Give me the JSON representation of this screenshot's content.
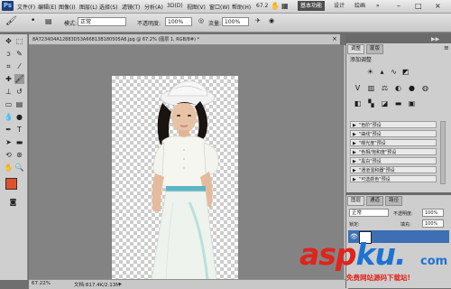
{
  "menu": {
    "logo": "Ps",
    "items": [
      "文件(F)",
      "编辑(E)",
      "图像(I)",
      "图层(L)",
      "选择(S)",
      "滤镜(T)",
      "分析(A)",
      "3D(D)",
      "视图(V)",
      "窗口(W)",
      "帮助(H)"
    ],
    "zoom": "67.2",
    "workspace": "基本功能",
    "design": "设计",
    "painting": "绘画",
    "more": "»"
  },
  "options": {
    "mode_label": "模式:",
    "mode_value": "正常",
    "opacity_label": "不透明度:",
    "opacity_value": "100%",
    "flow_label": "流量:",
    "flow_value": "100%"
  },
  "document": {
    "title": "8A7234D4A12883D53A66813B180505A8.jpg @ 67.2% (图层 1, RGB/8#) *",
    "close": "×"
  },
  "status": {
    "zoom": "67.22%",
    "doc_size": "文档:817.4K/2.13M"
  },
  "adjustments": {
    "tab_adjust": "调整",
    "tab_mask": "蒙版",
    "header": "添加调整",
    "presets": [
      "\"色阶\"预设",
      "\"曲线\"预设",
      "\"曝光度\"预设",
      "\"色相/饱和度\"预设",
      "\"黑白\"预设",
      "\"通道混和器\"预设",
      "\"可选颜色\"预设"
    ]
  },
  "layers": {
    "tab_layers": "图层",
    "tab_channels": "通道",
    "tab_paths": "路径",
    "blend_mode": "正常",
    "opacity_label": "不透明度:",
    "opacity_value": "100%",
    "lock_label": "锁定:",
    "fill_label": "填充:",
    "fill_value": "100%"
  },
  "watermark": {
    "logo_main": "asp",
    "logo_ku": "ku",
    "logo_dot": ".",
    "logo_tld": "com",
    "slogan": "免费网站源码下载站!"
  },
  "colors": {
    "foreground": "#e0512b",
    "background": "#ffffff",
    "watermark_red": "#e0231b",
    "watermark_blue": "#1e73d2"
  }
}
